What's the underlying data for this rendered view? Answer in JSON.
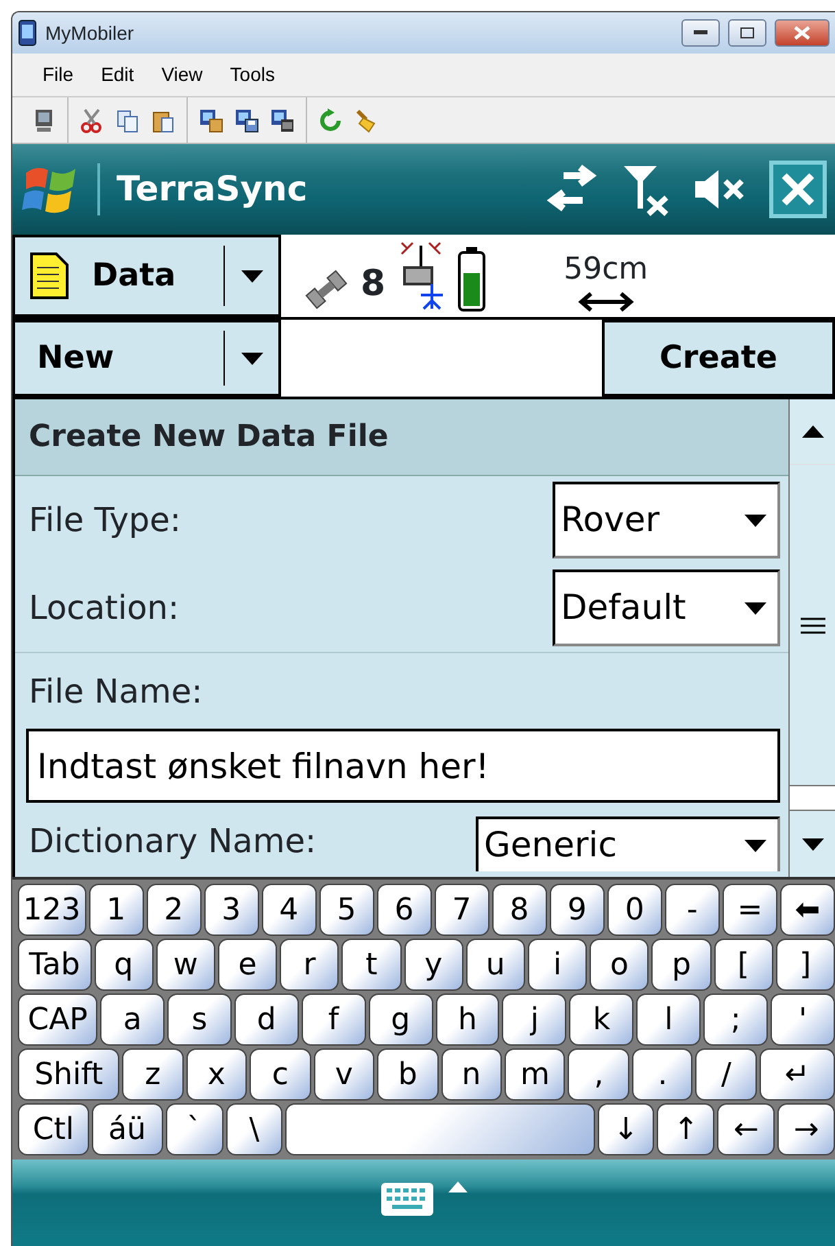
{
  "window": {
    "title": "MyMobiler"
  },
  "menu": [
    "File",
    "Edit",
    "View",
    "Tools"
  ],
  "app_bar": {
    "title": "TerraSync"
  },
  "data_row": {
    "section": "Data",
    "satellites": "8",
    "precision": "59cm"
  },
  "action_row": {
    "mode": "New",
    "button": "Create"
  },
  "form": {
    "title": "Create New Data File",
    "fields": [
      {
        "kind": "dropdown",
        "label": "File Type:",
        "value": "Rover"
      },
      {
        "kind": "dropdown",
        "label": "Location:",
        "value": "Default"
      },
      {
        "kind": "text",
        "label": "File Name:",
        "value": "Indtast ønsket filnavn her!"
      },
      {
        "kind": "dropdown",
        "label": "Dictionary Name:",
        "value": "Generic"
      }
    ]
  },
  "keyboard": {
    "rows": [
      {
        "keys": [
          {
            "label": "123",
            "kind": "wide"
          },
          {
            "label": "1",
            "kind": "key"
          },
          {
            "label": "2",
            "kind": "key"
          },
          {
            "label": "3",
            "kind": "key"
          },
          {
            "label": "4",
            "kind": "key"
          },
          {
            "label": "5",
            "kind": "key"
          },
          {
            "label": "6",
            "kind": "key"
          },
          {
            "label": "7",
            "kind": "key"
          },
          {
            "label": "8",
            "kind": "key"
          },
          {
            "label": "9",
            "kind": "key"
          },
          {
            "label": "0",
            "kind": "key"
          },
          {
            "label": "-",
            "kind": "key"
          },
          {
            "label": "=",
            "kind": "key"
          },
          {
            "label": "⬅",
            "kind": "key"
          }
        ]
      },
      {
        "keys": [
          {
            "label": "Tab",
            "kind": "wide"
          },
          {
            "label": "q",
            "kind": "key"
          },
          {
            "label": "w",
            "kind": "key"
          },
          {
            "label": "e",
            "kind": "key"
          },
          {
            "label": "r",
            "kind": "key"
          },
          {
            "label": "t",
            "kind": "key"
          },
          {
            "label": "y",
            "kind": "key"
          },
          {
            "label": "u",
            "kind": "key"
          },
          {
            "label": "i",
            "kind": "key"
          },
          {
            "label": "o",
            "kind": "key"
          },
          {
            "label": "p",
            "kind": "key"
          },
          {
            "label": "[",
            "kind": "key"
          },
          {
            "label": "]",
            "kind": "key"
          }
        ]
      },
      {
        "keys": [
          {
            "label": "CAP",
            "kind": "wide"
          },
          {
            "label": "a",
            "kind": "key"
          },
          {
            "label": "s",
            "kind": "key"
          },
          {
            "label": "d",
            "kind": "key"
          },
          {
            "label": "f",
            "kind": "key"
          },
          {
            "label": "g",
            "kind": "key"
          },
          {
            "label": "h",
            "kind": "key"
          },
          {
            "label": "j",
            "kind": "key"
          },
          {
            "label": "k",
            "kind": "key"
          },
          {
            "label": "l",
            "kind": "key"
          },
          {
            "label": ";",
            "kind": "key"
          },
          {
            "label": "'",
            "kind": "key"
          }
        ]
      },
      {
        "keys": [
          {
            "label": "Shift",
            "kind": "wider"
          },
          {
            "label": "z",
            "kind": "key"
          },
          {
            "label": "x",
            "kind": "key"
          },
          {
            "label": "c",
            "kind": "key"
          },
          {
            "label": "v",
            "kind": "key"
          },
          {
            "label": "b",
            "kind": "key"
          },
          {
            "label": "n",
            "kind": "key"
          },
          {
            "label": "m",
            "kind": "key"
          },
          {
            "label": ",",
            "kind": "key"
          },
          {
            "label": ".",
            "kind": "key"
          },
          {
            "label": "/",
            "kind": "key"
          },
          {
            "label": "↵",
            "kind": "wide"
          }
        ]
      },
      {
        "keys": [
          {
            "label": "Ctl",
            "kind": "wide"
          },
          {
            "label": "áü",
            "kind": "wide"
          },
          {
            "label": "`",
            "kind": "key"
          },
          {
            "label": "\\",
            "kind": "key"
          },
          {
            "kind": "space"
          },
          {
            "label": "↓",
            "kind": "key"
          },
          {
            "label": "↑",
            "kind": "key"
          },
          {
            "label": "←",
            "kind": "key"
          },
          {
            "label": "→",
            "kind": "key"
          }
        ]
      }
    ]
  }
}
